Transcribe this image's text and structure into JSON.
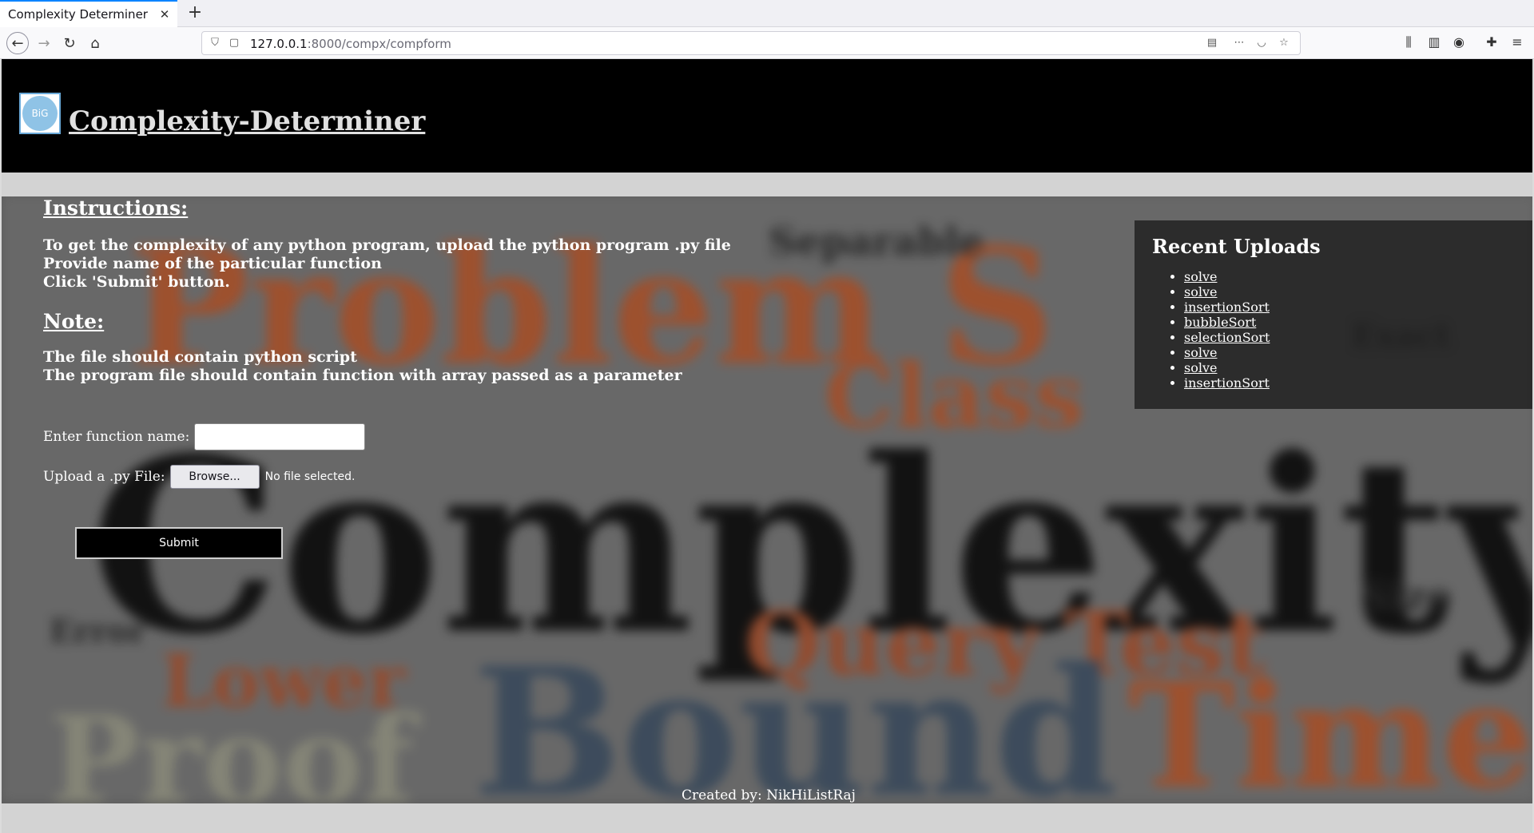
{
  "browser": {
    "tab_title": "Complexity Determiner",
    "url_host": "127.0.0.1",
    "url_rest": ":8000/compx/compform"
  },
  "header": {
    "logo_text": "BiG",
    "title": "Complexity-Determiner"
  },
  "instructions": {
    "heading": "Instructions:",
    "lines": [
      "To get the complexity of any python program, upload the python program .py file",
      "Provide name of the particular function",
      "Click 'Submit' button."
    ]
  },
  "note": {
    "heading": "Note:",
    "lines": [
      "The file should contain python script",
      "The program file should contain function with array passed as a parameter"
    ]
  },
  "form": {
    "function_label": "Enter function name:",
    "function_value": "",
    "upload_label": "Upload a .py File:",
    "browse_label": "Browse...",
    "no_file_text": "No file selected.",
    "submit_label": "Submit"
  },
  "recent": {
    "title": "Recent Uploads",
    "items": [
      "solve",
      "solve",
      "insertionSort",
      "bubbleSort",
      "selectionSort",
      "solve",
      "solve",
      "insertionSort"
    ]
  },
  "footer": {
    "text": "Created by: NikHiListRaj"
  },
  "colors": {
    "header_bg": "#000000",
    "strip": "#d3d3d3",
    "accent_tab": "#0a84ff"
  }
}
